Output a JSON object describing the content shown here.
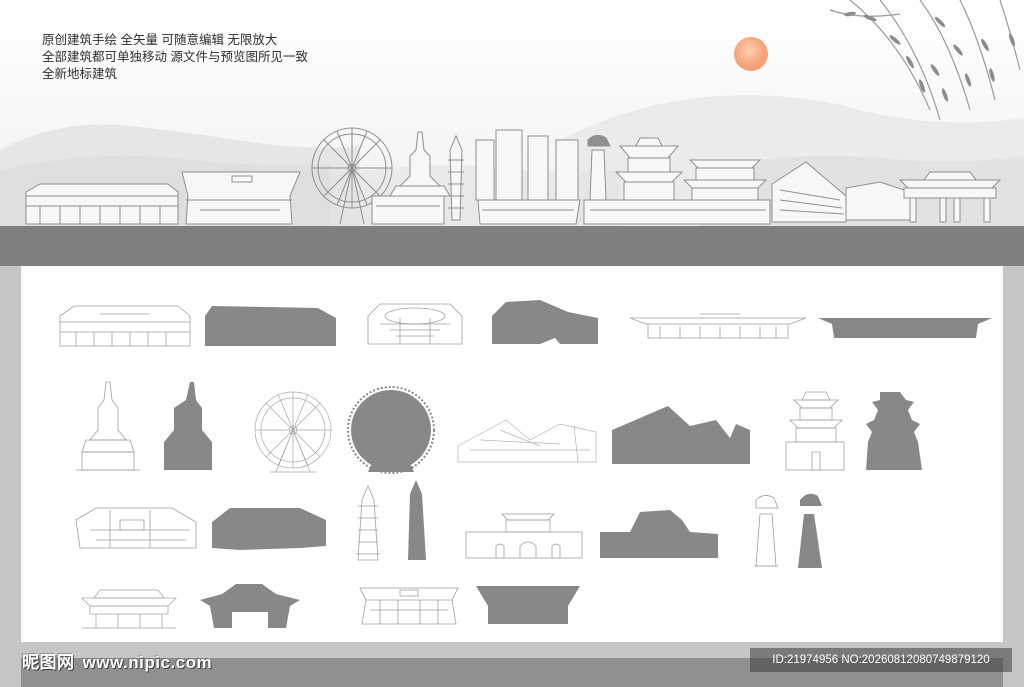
{
  "captions": [
    "原创建筑手绘  全矢量  可随意编辑  无限放大",
    "全部建筑都可单独移动  源文件与预览图所见一致",
    "全新地标建筑"
  ],
  "colors": {
    "silhouette": "#888888",
    "line_art": "#9a9a9a",
    "frame": "#c6c6c6",
    "band": "#7f7f7f",
    "sun": "#f6a277"
  },
  "watermark": {
    "site_logo": "昵图网",
    "site_url": "www.nipic.com",
    "id_text": "ID:21974956 NO:20260812080749879120"
  },
  "skyline_icons": [
    "museum-building-icon",
    "exhibition-hall-icon",
    "ferris-wheel-icon",
    "white-pagoda-icon",
    "brick-pagoda-icon",
    "office-towers-icon",
    "horse-statue-monument-icon",
    "pavilion-tower-icon",
    "drum-tower-icon",
    "modern-arena-icon",
    "ceremonial-gate-icon"
  ],
  "gallery_icons": [
    "museum-outline-icon",
    "museum-silhouette-icon",
    "exhibition-hall-outline-icon",
    "exhibition-hall-silhouette-icon",
    "railway-station-outline-icon",
    "railway-station-silhouette-icon",
    "white-pagoda-outline-icon",
    "white-pagoda-silhouette-icon",
    "ferris-wheel-outline-icon",
    "ferris-wheel-silhouette-icon",
    "modern-arena-outline-icon",
    "modern-arena-silhouette-icon",
    "pavilion-tower-outline-icon",
    "pavilion-tower-silhouette-icon",
    "library-outline-icon",
    "library-silhouette-icon",
    "brick-pagoda-outline-icon",
    "brick-pagoda-silhouette-icon",
    "city-gate-outline-icon",
    "city-gate-silhouette-icon",
    "horse-monument-outline-icon",
    "horse-monument-silhouette-icon",
    "archway-outline-icon",
    "archway-silhouette-icon",
    "stadium-outline-icon",
    "stadium-silhouette-icon"
  ]
}
